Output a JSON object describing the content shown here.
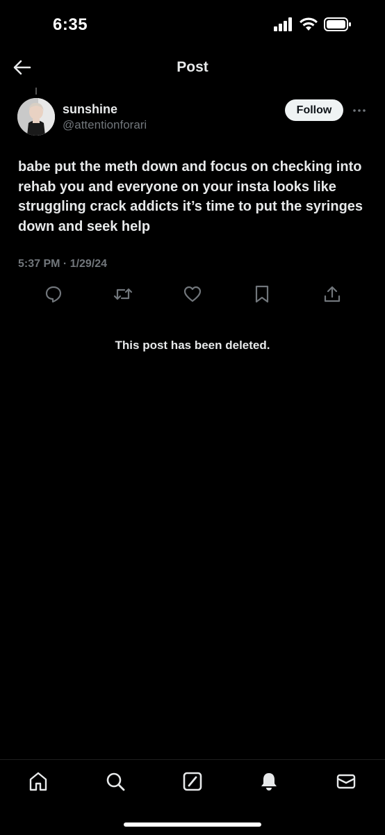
{
  "status_bar": {
    "time": "6:35"
  },
  "header": {
    "title": "Post",
    "back_icon": "arrow-left-icon"
  },
  "post": {
    "author": {
      "display_name": "sunshine",
      "handle": "@attentionforari"
    },
    "follow_label": "Follow",
    "text": "babe put the meth down and focus on checking into rehab you and everyone on your insta looks like struggling crack addicts it’s time to put the syringes down and seek help",
    "timestamp": "5:37 PM · 1/29/24",
    "actions": [
      "reply-icon",
      "repost-icon",
      "like-icon",
      "bookmark-icon",
      "share-icon"
    ]
  },
  "deleted_notice": "This post has been deleted.",
  "tab_bar": {
    "items": [
      "home-icon",
      "search-icon",
      "compose-icon",
      "notifications-icon",
      "messages-icon"
    ]
  },
  "colors": {
    "background": "#000000",
    "text_primary": "#e7e9ea",
    "text_secondary": "#71767b",
    "follow_bg": "#eff3f4"
  }
}
